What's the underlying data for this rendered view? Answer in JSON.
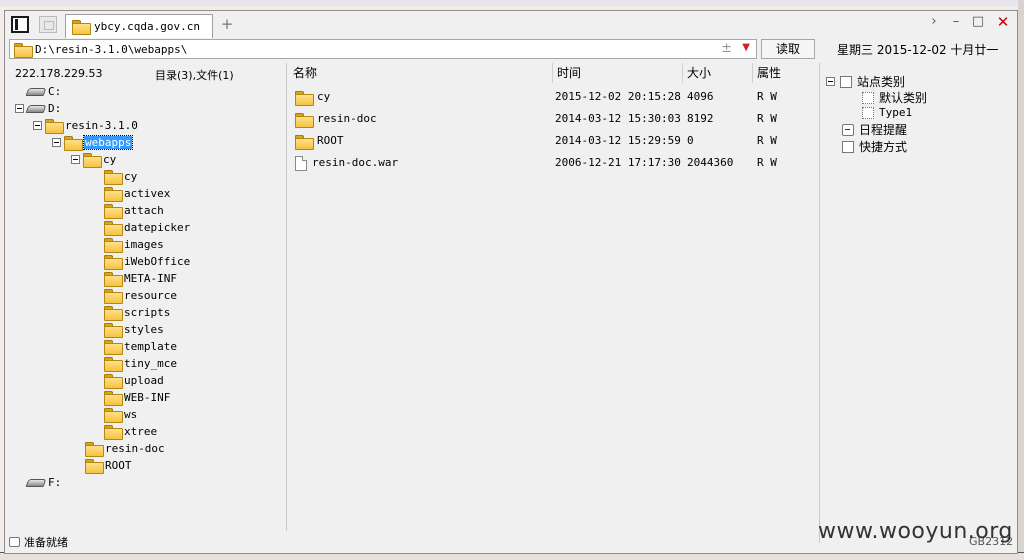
{
  "tabs": [
    {
      "label": "ybcy.cqda.gov.cn",
      "active": true
    }
  ],
  "address": {
    "path": "D:\\resin-3.1.0\\webapps\\",
    "read_label": "读取"
  },
  "calendar": {
    "weekday": "星期三",
    "date": "2015-12-02",
    "lunar": "十月廿一"
  },
  "tree": {
    "host": "222.178.229.53",
    "summary": "目录(3),文件(1)",
    "nodes": [
      {
        "label": "C:",
        "type": "drive"
      },
      {
        "label": "D:",
        "type": "drive"
      },
      {
        "label": "resin-3.1.0",
        "type": "folder"
      },
      {
        "label": "webapps",
        "type": "folder",
        "selected": true
      },
      {
        "label": "cy",
        "type": "folder"
      },
      {
        "label": "cy",
        "type": "folder"
      },
      {
        "label": "activex",
        "type": "folder"
      },
      {
        "label": "attach",
        "type": "folder"
      },
      {
        "label": "datepicker",
        "type": "folder"
      },
      {
        "label": "images",
        "type": "folder"
      },
      {
        "label": "iWebOffice",
        "type": "folder"
      },
      {
        "label": "META-INF",
        "type": "folder"
      },
      {
        "label": "resource",
        "type": "folder"
      },
      {
        "label": "scripts",
        "type": "folder"
      },
      {
        "label": "styles",
        "type": "folder"
      },
      {
        "label": "template",
        "type": "folder"
      },
      {
        "label": "tiny_mce",
        "type": "folder"
      },
      {
        "label": "upload",
        "type": "folder"
      },
      {
        "label": "WEB-INF",
        "type": "folder"
      },
      {
        "label": "ws",
        "type": "folder"
      },
      {
        "label": "xtree",
        "type": "folder"
      },
      {
        "label": "resin-doc",
        "type": "folder"
      },
      {
        "label": "ROOT",
        "type": "folder"
      },
      {
        "label": "F:",
        "type": "drive"
      }
    ]
  },
  "files": {
    "columns": {
      "name": "名称",
      "time": "时间",
      "size": "大小",
      "attr": "属性"
    },
    "rows": [
      {
        "name": "cy",
        "type": "folder",
        "time": "2015-12-02 20:15:28",
        "size": "4096",
        "attr": "R W"
      },
      {
        "name": "resin-doc",
        "type": "folder",
        "time": "2014-03-12 15:30:03",
        "size": "8192",
        "attr": "R W"
      },
      {
        "name": "ROOT",
        "type": "folder",
        "time": "2014-03-12 15:29:59",
        "size": "0",
        "attr": "R W"
      },
      {
        "name": "resin-doc.war",
        "type": "file",
        "time": "2006-12-21 17:17:30",
        "size": "2044360",
        "attr": "R W"
      }
    ]
  },
  "categories": {
    "root": "站点类别",
    "children": [
      "默认类别",
      "Type1"
    ],
    "reminders": "日程提醒",
    "shortcuts": "快捷方式"
  },
  "status": {
    "text": "准备就绪",
    "encoding": "GB2312",
    "watermark": "www.wooyun.org"
  },
  "colors": {
    "selection": "#3399ff",
    "folder": "#f4c240"
  }
}
